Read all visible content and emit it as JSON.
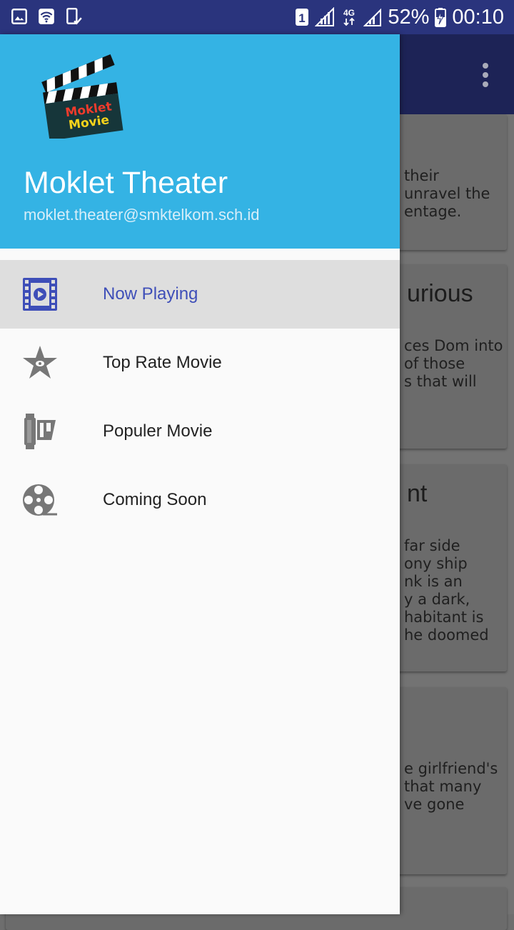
{
  "status_bar": {
    "sim": "1",
    "network": "4G",
    "battery": "52%",
    "time": "00:10"
  },
  "drawer": {
    "logo_text_top": "Moklet",
    "logo_text_bottom": "Movie",
    "title": "Moklet Theater",
    "email": "moklet.theater@smktelkom.sch.id",
    "menu": [
      {
        "label": "Now Playing",
        "icon": "movie-film-icon",
        "active": true
      },
      {
        "label": "Top Rate Movie",
        "icon": "star-icon",
        "active": false
      },
      {
        "label": "Populer Movie",
        "icon": "film-roll-icon",
        "active": false
      },
      {
        "label": "Coming Soon",
        "icon": "film-reel-icon",
        "active": false
      }
    ]
  },
  "background": {
    "cards": [
      {
        "title": "",
        "lines": [
          "their",
          "unravel the",
          "entage."
        ]
      },
      {
        "title": "urious",
        "lines": [
          "ces Dom into",
          "of those",
          "s that will"
        ]
      },
      {
        "title": "nt",
        "lines": [
          "far side",
          "ony ship",
          "nk is an",
          "y a dark,",
          "habitant is",
          "he doomed"
        ]
      },
      {
        "title": "",
        "lines": [
          "e girlfriend's",
          "that many",
          "ve gone"
        ]
      }
    ]
  },
  "colors": {
    "status_bar": "#2a347d",
    "app_bar": "#1d2356",
    "drawer_header": "#34b3e4",
    "active_item_bg": "#dedede",
    "active_label": "#3e4eb8",
    "icon_active": "#3e4eb8",
    "icon_inactive": "#777777"
  }
}
